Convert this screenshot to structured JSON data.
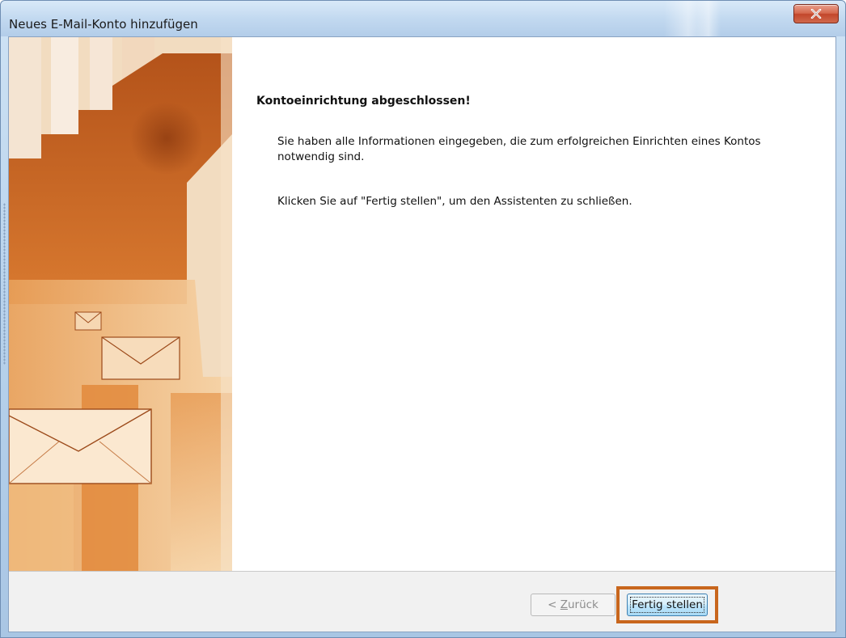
{
  "window": {
    "title": "Neues E-Mail-Konto hinzufügen",
    "close_icon": "close-icon"
  },
  "content": {
    "heading": "Kontoeinrichtung abgeschlossen!",
    "paragraph1": "Sie haben alle Informationen eingegeben, die zum erfolgreichen Einrichten eines Kontos notwendig sind.",
    "paragraph2": "Klicken Sie auf \"Fertig stellen\", um den Assistenten zu schließen."
  },
  "footer": {
    "back_prefix": "< ",
    "back_mnemonic": "Z",
    "back_rest": "urück",
    "back_enabled": false,
    "finish_label": "Fertig stellen",
    "highlight_color": "#c8661d"
  },
  "colors": {
    "art_dark": "#c25a1c",
    "art_mid": "#e39a52",
    "art_light": "#f3d2a6"
  }
}
